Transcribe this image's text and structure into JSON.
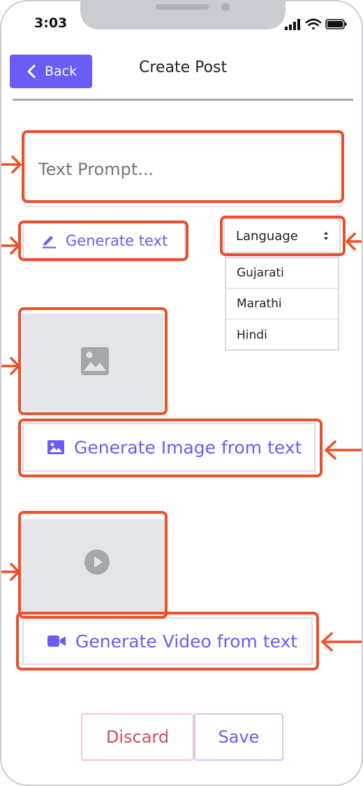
{
  "status_bar": {
    "time": "3:03",
    "icons": [
      "signal-icon",
      "wifi-icon",
      "battery-icon"
    ]
  },
  "header": {
    "back_label": "Back",
    "title": "Create Post"
  },
  "prompt": {
    "placeholder": "Text Prompt...",
    "value": ""
  },
  "generate_text": {
    "label": "Generate text",
    "icon": "pen-icon"
  },
  "language": {
    "selected": "Language",
    "options": [
      "Gujarati",
      "Marathi",
      "Hindi"
    ]
  },
  "media": {
    "image_placeholder_icon": "image-icon",
    "video_placeholder_icon": "play-icon"
  },
  "generate_image": {
    "label": "Generate Image from text",
    "icon": "image-icon"
  },
  "generate_video": {
    "label": "Generate Video from text",
    "icon": "video-camera-icon"
  },
  "actions": {
    "discard_label": "Discard",
    "save_label": "Save"
  },
  "colors": {
    "accent": "#6b5cf6",
    "annotation": "#ec4f2a",
    "danger_text": "#d24a5e",
    "placeholder_bg": "#e3e5e8"
  }
}
